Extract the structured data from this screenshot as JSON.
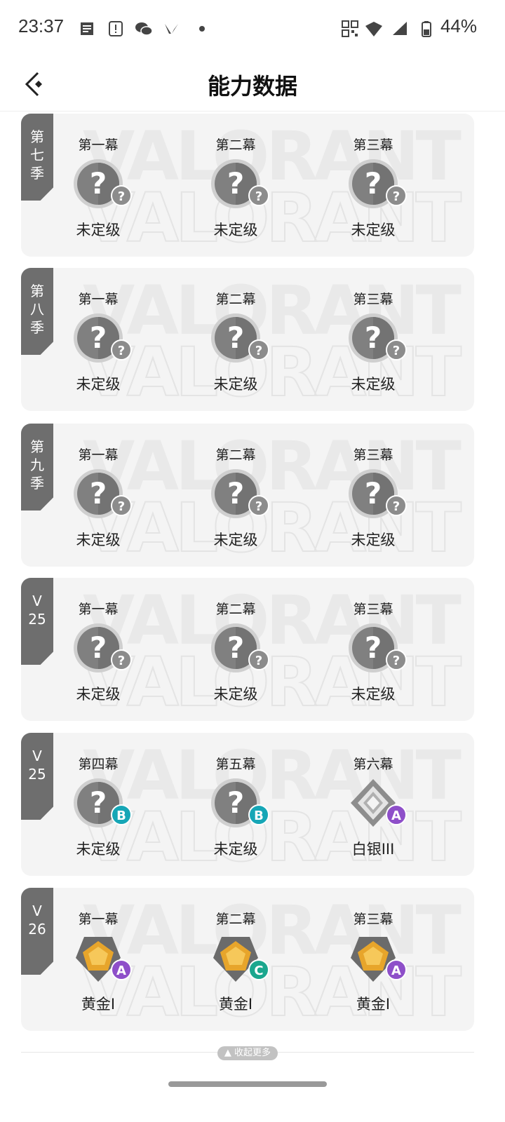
{
  "status_bar": {
    "time": "23:37",
    "battery": "44%"
  },
  "header": {
    "title": "能力数据"
  },
  "watermark": {
    "line1": "VALORANT",
    "line2": "VALORANT"
  },
  "cards": [
    {
      "season": "第\n七\n季",
      "slots": [
        {
          "act": "第一幕",
          "badge": "?",
          "rank": "未定级",
          "icon": "unranked"
        },
        {
          "act": "第二幕",
          "badge": "?",
          "rank": "未定级",
          "icon": "unranked"
        },
        {
          "act": "第三幕",
          "badge": "?",
          "rank": "未定级",
          "icon": "unranked"
        }
      ]
    },
    {
      "season": "第\n八\n季",
      "slots": [
        {
          "act": "第一幕",
          "badge": "?",
          "rank": "未定级",
          "icon": "unranked"
        },
        {
          "act": "第二幕",
          "badge": "?",
          "rank": "未定级",
          "icon": "unranked"
        },
        {
          "act": "第三幕",
          "badge": "?",
          "rank": "未定级",
          "icon": "unranked"
        }
      ]
    },
    {
      "season": "第\n九\n季",
      "slots": [
        {
          "act": "第一幕",
          "badge": "?",
          "rank": "未定级",
          "icon": "unranked"
        },
        {
          "act": "第二幕",
          "badge": "?",
          "rank": "未定级",
          "icon": "unranked"
        },
        {
          "act": "第三幕",
          "badge": "?",
          "rank": "未定级",
          "icon": "unranked"
        }
      ]
    },
    {
      "season": "V\n25",
      "slots": [
        {
          "act": "第一幕",
          "badge": "?",
          "rank": "未定级",
          "icon": "unranked"
        },
        {
          "act": "第二幕",
          "badge": "?",
          "rank": "未定级",
          "icon": "unranked"
        },
        {
          "act": "第三幕",
          "badge": "?",
          "rank": "未定级",
          "icon": "unranked"
        }
      ]
    },
    {
      "season": "V\n25",
      "slots": [
        {
          "act": "第四幕",
          "badge": "B",
          "rank": "未定级",
          "icon": "unranked"
        },
        {
          "act": "第五幕",
          "badge": "B",
          "rank": "未定级",
          "icon": "unranked"
        },
        {
          "act": "第六幕",
          "badge": "A",
          "rank": "白银III",
          "icon": "silver"
        }
      ]
    },
    {
      "season": "V\n26",
      "slots": [
        {
          "act": "第一幕",
          "badge": "A",
          "rank": "黄金I",
          "icon": "gold"
        },
        {
          "act": "第二幕",
          "badge": "C",
          "rank": "黄金I",
          "icon": "gold"
        },
        {
          "act": "第三幕",
          "badge": "A",
          "rank": "黄金I",
          "icon": "gold"
        }
      ]
    }
  ],
  "footer": {
    "collapse_label": "▲ 收起更多"
  }
}
